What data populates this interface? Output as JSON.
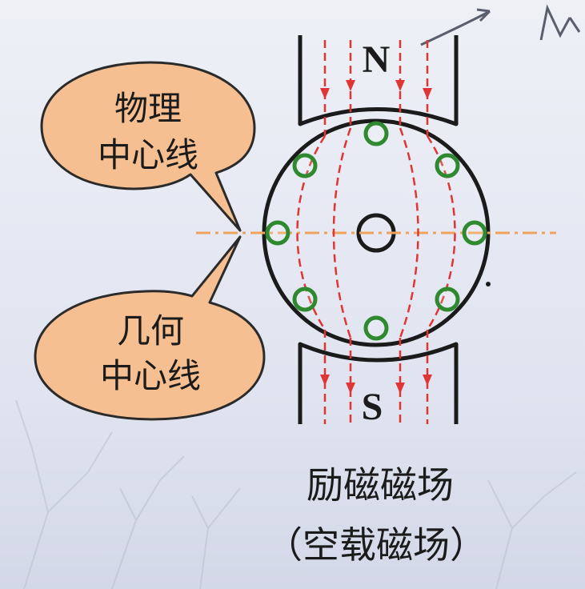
{
  "bubbles": {
    "physical_neutral": {
      "line1": "物理",
      "line2": "中心线"
    },
    "geometric_neutral": {
      "line1": "几何",
      "line2": "中心线"
    }
  },
  "poles": {
    "north": "N",
    "south": "S"
  },
  "caption": {
    "line1": "励磁磁场",
    "line2": "（空载磁场）"
  },
  "colors": {
    "bubble_fill": "#f6bf91",
    "bubble_stroke": "#2b2b2b",
    "field_lines": "#e03535",
    "neutral_line": "#f0a35a",
    "conductors": "#2f8a2f",
    "outline": "#1b1b1b"
  }
}
